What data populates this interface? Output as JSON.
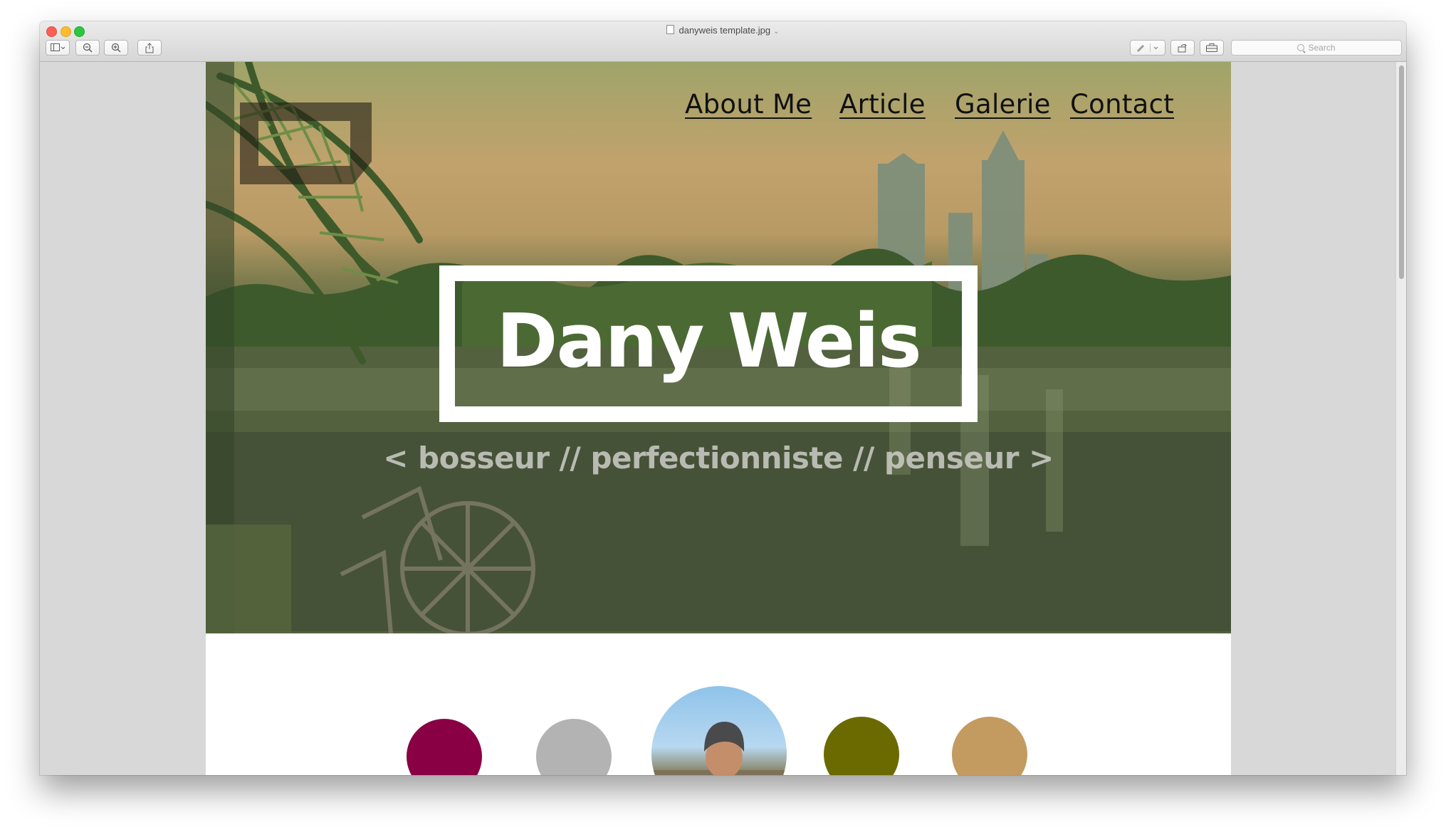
{
  "window": {
    "title": "danyweis template.jpg",
    "search_placeholder": "Search"
  },
  "site": {
    "nav": [
      "About Me",
      "Article",
      "Galerie",
      "Contact"
    ],
    "hero_title": "Dany Weis",
    "tagline": "< bosseur // perfectionniste // penseur >",
    "swatches": [
      "#8a0044",
      "#b3b3b3",
      "#6b6a00",
      "#c39b60"
    ]
  }
}
